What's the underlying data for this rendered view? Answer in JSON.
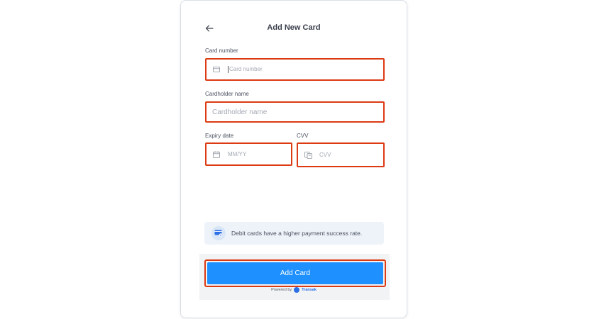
{
  "header": {
    "title": "Add New Card"
  },
  "fields": {
    "card_number": {
      "label": "Card number",
      "placeholder": "Card number"
    },
    "cardholder_name": {
      "label": "Cardholder name",
      "placeholder": "Cardholder name"
    },
    "expiry": {
      "label": "Expiry date",
      "placeholder": "MM/YY"
    },
    "cvv": {
      "label": "CVV",
      "placeholder": "CVV"
    }
  },
  "info": {
    "text": "Debit cards have a higher payment success rate."
  },
  "actions": {
    "add_card": "Add Card"
  },
  "footer": {
    "powered_by": "Powered by",
    "brand": "Transak"
  },
  "icons": {
    "back": "arrow-left-icon",
    "card": "credit-card-icon",
    "calendar": "calendar-icon",
    "cvv": "cvv-card-icon",
    "info": "card-check-icon"
  },
  "colors": {
    "highlight": "#dc3a12",
    "primary": "#1e90ff",
    "brand": "#2a6fe6"
  }
}
